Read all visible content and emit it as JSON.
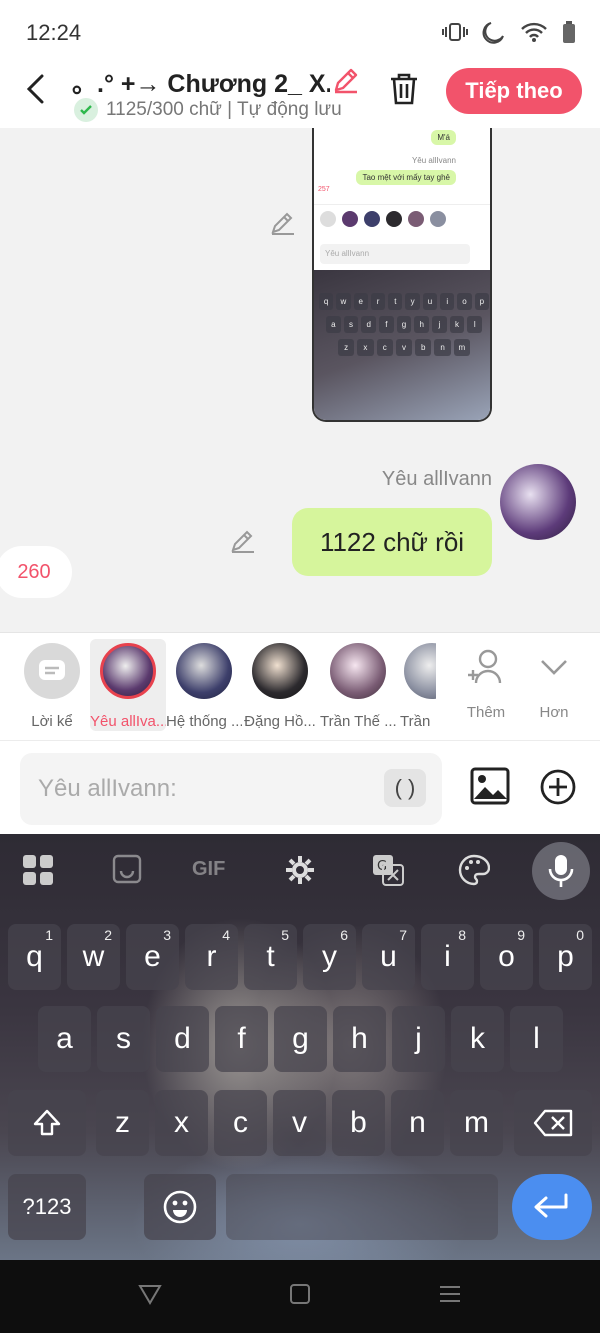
{
  "status_bar": {
    "time": "12:24"
  },
  "header": {
    "title": "。.° +→ Chương 2_ X...",
    "subtitle": "1125/300 chữ | Tự động lưu",
    "next_label": "Tiếp theo"
  },
  "chat": {
    "screenshot": {
      "msg_top": "M'á",
      "sender": "Yêu allIvann",
      "msg": "Tao mệt với mấy tay ghẻ",
      "count": "257",
      "input_placeholder": "Yêu allIvann",
      "row1": [
        "q",
        "w",
        "e",
        "r",
        "t",
        "y",
        "u",
        "i",
        "o",
        "p"
      ],
      "row2": [
        "a",
        "s",
        "d",
        "f",
        "g",
        "h",
        "j",
        "k",
        "l"
      ],
      "row3": [
        "z",
        "x",
        "c",
        "v",
        "b",
        "n",
        "m"
      ]
    },
    "sender_name": "Yêu allIvann",
    "message": "1122 chữ rồi",
    "count": "260"
  },
  "characters": [
    {
      "label": "Lời kể",
      "color": "#d9d9d9"
    },
    {
      "label": "Yêu allIva...",
      "color": "#5b3a6e"
    },
    {
      "label": "Hệ thống ...",
      "color": "#3d3f6b"
    },
    {
      "label": "Đặng Hồ...",
      "color": "#2c2a2e"
    },
    {
      "label": "Trần Thế ...",
      "color": "#7a5c74"
    },
    {
      "label": "Trần",
      "color": "#8a8fa0"
    }
  ],
  "tools": {
    "add_label": "Thêm",
    "more_label": "Hơn"
  },
  "input": {
    "placeholder": "Yêu allIvann:",
    "paren": "( )"
  },
  "keyboard": {
    "row1": [
      {
        "k": "q",
        "h": "1"
      },
      {
        "k": "w",
        "h": "2"
      },
      {
        "k": "e",
        "h": "3"
      },
      {
        "k": "r",
        "h": "4"
      },
      {
        "k": "t",
        "h": "5"
      },
      {
        "k": "y",
        "h": "6"
      },
      {
        "k": "u",
        "h": "7"
      },
      {
        "k": "i",
        "h": "8"
      },
      {
        "k": "o",
        "h": "9"
      },
      {
        "k": "p",
        "h": "0"
      }
    ],
    "row2": [
      "a",
      "s",
      "d",
      "f",
      "g",
      "h",
      "j",
      "k",
      "l"
    ],
    "row3": [
      "z",
      "x",
      "c",
      "v",
      "b",
      "n",
      "m"
    ],
    "numbers_label": "?123",
    "gif_label": "GIF"
  },
  "colors": {
    "accent": "#f2536b",
    "bubble": "#d6f59c",
    "enter": "#4b8ef0"
  }
}
